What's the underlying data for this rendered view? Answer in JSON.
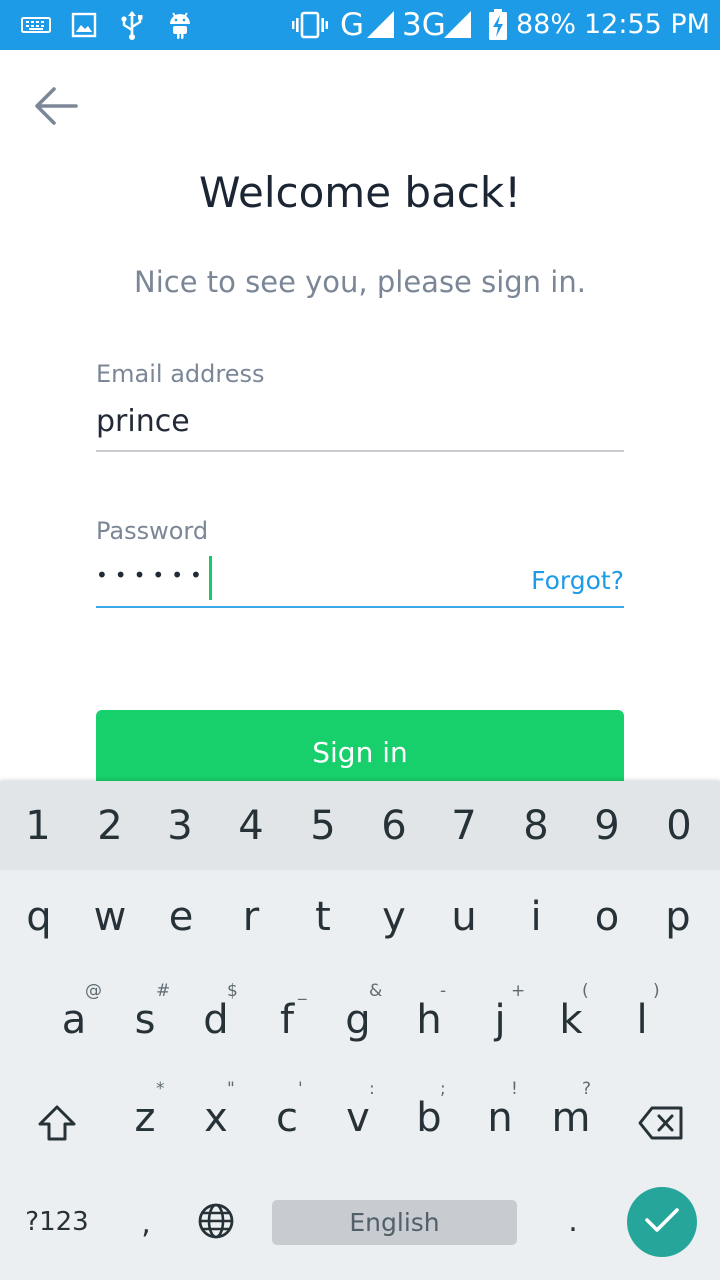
{
  "status_bar": {
    "network_g": "G",
    "network_3g": "3G",
    "battery_percent": "88%",
    "time": "12:55 PM",
    "background_color": "#1e9be6",
    "icons": [
      "keyboard-icon",
      "image-icon",
      "usb-icon",
      "android-icon",
      "vibrate-icon",
      "signal-icon",
      "signal-3g-icon",
      "battery-charging-icon"
    ]
  },
  "header": {
    "back_icon": "arrow-left-icon",
    "title": "Welcome back!",
    "subtitle": "Nice to see you, please sign in."
  },
  "form": {
    "email": {
      "label": "Email address",
      "value": "prince"
    },
    "password": {
      "label": "Password",
      "masked_value": "••••••",
      "forgot_link": "Forgot?"
    },
    "sign_in_button": "Sign in",
    "accent_color": "#17cf6b",
    "link_color": "#1e9be6"
  },
  "keyboard": {
    "number_row": [
      "1",
      "2",
      "3",
      "4",
      "5",
      "6",
      "7",
      "8",
      "9",
      "0"
    ],
    "row1": [
      "q",
      "w",
      "e",
      "r",
      "t",
      "y",
      "u",
      "i",
      "o",
      "p"
    ],
    "row2": [
      {
        "key": "a",
        "hint": "@"
      },
      {
        "key": "s",
        "hint": "#"
      },
      {
        "key": "d",
        "hint": "$"
      },
      {
        "key": "f",
        "hint": "_"
      },
      {
        "key": "g",
        "hint": "&"
      },
      {
        "key": "h",
        "hint": "-"
      },
      {
        "key": "j",
        "hint": "+"
      },
      {
        "key": "k",
        "hint": "("
      },
      {
        "key": "l",
        "hint": ")"
      }
    ],
    "row3": [
      {
        "key": "z",
        "hint": "*"
      },
      {
        "key": "x",
        "hint": "\""
      },
      {
        "key": "c",
        "hint": "'"
      },
      {
        "key": "v",
        "hint": ":"
      },
      {
        "key": "b",
        "hint": ";"
      },
      {
        "key": "n",
        "hint": "!"
      },
      {
        "key": "m",
        "hint": "?"
      }
    ],
    "symbols_key": "?123",
    "comma_key": ",",
    "space_label": "English",
    "period_key": ".",
    "enter_color": "#26a69a"
  }
}
